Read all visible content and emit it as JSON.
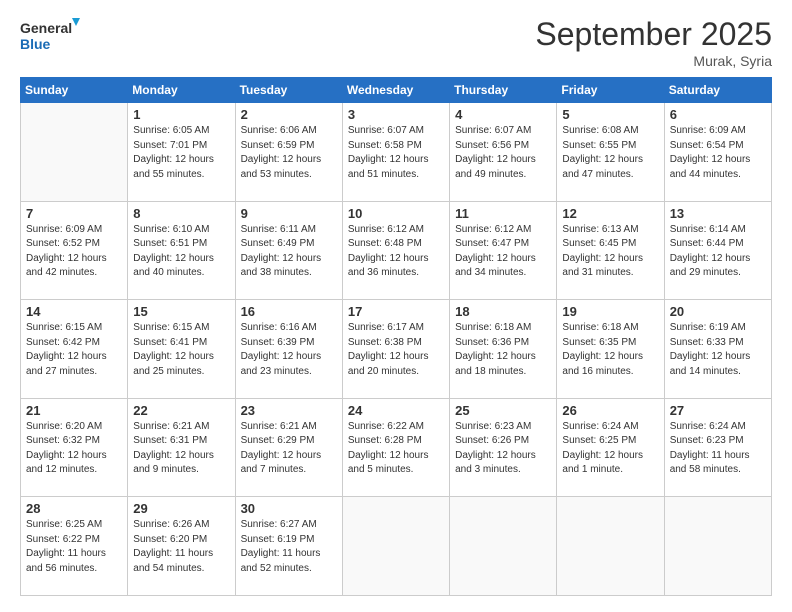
{
  "logo": {
    "line1": "General",
    "line2": "Blue"
  },
  "title": "September 2025",
  "location": "Murak, Syria",
  "days_of_week": [
    "Sunday",
    "Monday",
    "Tuesday",
    "Wednesday",
    "Thursday",
    "Friday",
    "Saturday"
  ],
  "weeks": [
    [
      {
        "num": "",
        "info": ""
      },
      {
        "num": "1",
        "info": "Sunrise: 6:05 AM\nSunset: 7:01 PM\nDaylight: 12 hours\nand 55 minutes."
      },
      {
        "num": "2",
        "info": "Sunrise: 6:06 AM\nSunset: 6:59 PM\nDaylight: 12 hours\nand 53 minutes."
      },
      {
        "num": "3",
        "info": "Sunrise: 6:07 AM\nSunset: 6:58 PM\nDaylight: 12 hours\nand 51 minutes."
      },
      {
        "num": "4",
        "info": "Sunrise: 6:07 AM\nSunset: 6:56 PM\nDaylight: 12 hours\nand 49 minutes."
      },
      {
        "num": "5",
        "info": "Sunrise: 6:08 AM\nSunset: 6:55 PM\nDaylight: 12 hours\nand 47 minutes."
      },
      {
        "num": "6",
        "info": "Sunrise: 6:09 AM\nSunset: 6:54 PM\nDaylight: 12 hours\nand 44 minutes."
      }
    ],
    [
      {
        "num": "7",
        "info": "Sunrise: 6:09 AM\nSunset: 6:52 PM\nDaylight: 12 hours\nand 42 minutes."
      },
      {
        "num": "8",
        "info": "Sunrise: 6:10 AM\nSunset: 6:51 PM\nDaylight: 12 hours\nand 40 minutes."
      },
      {
        "num": "9",
        "info": "Sunrise: 6:11 AM\nSunset: 6:49 PM\nDaylight: 12 hours\nand 38 minutes."
      },
      {
        "num": "10",
        "info": "Sunrise: 6:12 AM\nSunset: 6:48 PM\nDaylight: 12 hours\nand 36 minutes."
      },
      {
        "num": "11",
        "info": "Sunrise: 6:12 AM\nSunset: 6:47 PM\nDaylight: 12 hours\nand 34 minutes."
      },
      {
        "num": "12",
        "info": "Sunrise: 6:13 AM\nSunset: 6:45 PM\nDaylight: 12 hours\nand 31 minutes."
      },
      {
        "num": "13",
        "info": "Sunrise: 6:14 AM\nSunset: 6:44 PM\nDaylight: 12 hours\nand 29 minutes."
      }
    ],
    [
      {
        "num": "14",
        "info": "Sunrise: 6:15 AM\nSunset: 6:42 PM\nDaylight: 12 hours\nand 27 minutes."
      },
      {
        "num": "15",
        "info": "Sunrise: 6:15 AM\nSunset: 6:41 PM\nDaylight: 12 hours\nand 25 minutes."
      },
      {
        "num": "16",
        "info": "Sunrise: 6:16 AM\nSunset: 6:39 PM\nDaylight: 12 hours\nand 23 minutes."
      },
      {
        "num": "17",
        "info": "Sunrise: 6:17 AM\nSunset: 6:38 PM\nDaylight: 12 hours\nand 20 minutes."
      },
      {
        "num": "18",
        "info": "Sunrise: 6:18 AM\nSunset: 6:36 PM\nDaylight: 12 hours\nand 18 minutes."
      },
      {
        "num": "19",
        "info": "Sunrise: 6:18 AM\nSunset: 6:35 PM\nDaylight: 12 hours\nand 16 minutes."
      },
      {
        "num": "20",
        "info": "Sunrise: 6:19 AM\nSunset: 6:33 PM\nDaylight: 12 hours\nand 14 minutes."
      }
    ],
    [
      {
        "num": "21",
        "info": "Sunrise: 6:20 AM\nSunset: 6:32 PM\nDaylight: 12 hours\nand 12 minutes."
      },
      {
        "num": "22",
        "info": "Sunrise: 6:21 AM\nSunset: 6:31 PM\nDaylight: 12 hours\nand 9 minutes."
      },
      {
        "num": "23",
        "info": "Sunrise: 6:21 AM\nSunset: 6:29 PM\nDaylight: 12 hours\nand 7 minutes."
      },
      {
        "num": "24",
        "info": "Sunrise: 6:22 AM\nSunset: 6:28 PM\nDaylight: 12 hours\nand 5 minutes."
      },
      {
        "num": "25",
        "info": "Sunrise: 6:23 AM\nSunset: 6:26 PM\nDaylight: 12 hours\nand 3 minutes."
      },
      {
        "num": "26",
        "info": "Sunrise: 6:24 AM\nSunset: 6:25 PM\nDaylight: 12 hours\nand 1 minute."
      },
      {
        "num": "27",
        "info": "Sunrise: 6:24 AM\nSunset: 6:23 PM\nDaylight: 11 hours\nand 58 minutes."
      }
    ],
    [
      {
        "num": "28",
        "info": "Sunrise: 6:25 AM\nSunset: 6:22 PM\nDaylight: 11 hours\nand 56 minutes."
      },
      {
        "num": "29",
        "info": "Sunrise: 6:26 AM\nSunset: 6:20 PM\nDaylight: 11 hours\nand 54 minutes."
      },
      {
        "num": "30",
        "info": "Sunrise: 6:27 AM\nSunset: 6:19 PM\nDaylight: 11 hours\nand 52 minutes."
      },
      {
        "num": "",
        "info": ""
      },
      {
        "num": "",
        "info": ""
      },
      {
        "num": "",
        "info": ""
      },
      {
        "num": "",
        "info": ""
      }
    ]
  ]
}
